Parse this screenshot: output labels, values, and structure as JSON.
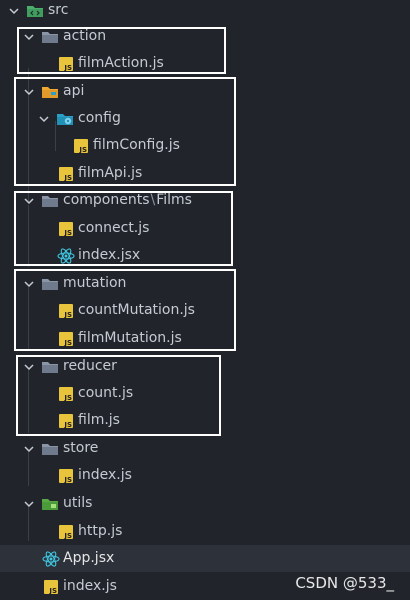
{
  "explorer": {
    "rows": [
      {
        "label": "src",
        "kind": "folder",
        "icon": "src-folder-icon",
        "open": true
      },
      {
        "label": "action",
        "kind": "folder",
        "icon": "folder-icon",
        "open": true
      },
      {
        "label": "filmAction.js",
        "kind": "file",
        "icon": "js-file-icon"
      },
      {
        "label": "api",
        "kind": "folder",
        "icon": "api-folder-icon",
        "open": true
      },
      {
        "label": "config",
        "kind": "folder",
        "icon": "config-folder-icon",
        "open": true
      },
      {
        "label": "filmConfig.js",
        "kind": "file",
        "icon": "js-file-icon"
      },
      {
        "label": "filmApi.js",
        "kind": "file",
        "icon": "js-file-icon"
      },
      {
        "label": "components",
        "label_sep": "\\",
        "label_tail": "Films",
        "kind": "folder",
        "icon": "folder-icon",
        "open": true
      },
      {
        "label": "connect.js",
        "kind": "file",
        "icon": "js-file-icon"
      },
      {
        "label": "index.jsx",
        "kind": "file",
        "icon": "react-icon"
      },
      {
        "label": "mutation",
        "kind": "folder",
        "icon": "folder-icon",
        "open": true
      },
      {
        "label": "countMutation.js",
        "kind": "file",
        "icon": "js-file-icon"
      },
      {
        "label": "filmMutation.js",
        "kind": "file",
        "icon": "js-file-icon"
      },
      {
        "label": "reducer",
        "kind": "folder",
        "icon": "folder-icon",
        "open": true
      },
      {
        "label": "count.js",
        "kind": "file",
        "icon": "js-file-icon"
      },
      {
        "label": "film.js",
        "kind": "file",
        "icon": "js-file-icon"
      },
      {
        "label": "store",
        "kind": "folder",
        "icon": "folder-icon",
        "open": true
      },
      {
        "label": "index.js",
        "kind": "file",
        "icon": "js-file-icon"
      },
      {
        "label": "utils",
        "kind": "folder",
        "icon": "utils-folder-icon",
        "open": true
      },
      {
        "label": "http.js",
        "kind": "file",
        "icon": "js-file-icon"
      },
      {
        "label": "App.jsx",
        "kind": "file",
        "icon": "react-icon",
        "selected": true
      },
      {
        "label": "index.js",
        "kind": "file",
        "icon": "js-file-icon"
      }
    ]
  },
  "watermark": "CSDN @533_",
  "colors": {
    "background": "#21252b",
    "selected_row": "#2c313a",
    "folder": "#8a95a6",
    "js_badge": "#e8c33c",
    "react": "#3fc6e0",
    "src_folder": "#4caf6e",
    "api_folder": "#f0a830",
    "config_folder": "#2aa0c8",
    "utils_folder": "#5aa845",
    "highlight_box": "#ffffff"
  }
}
